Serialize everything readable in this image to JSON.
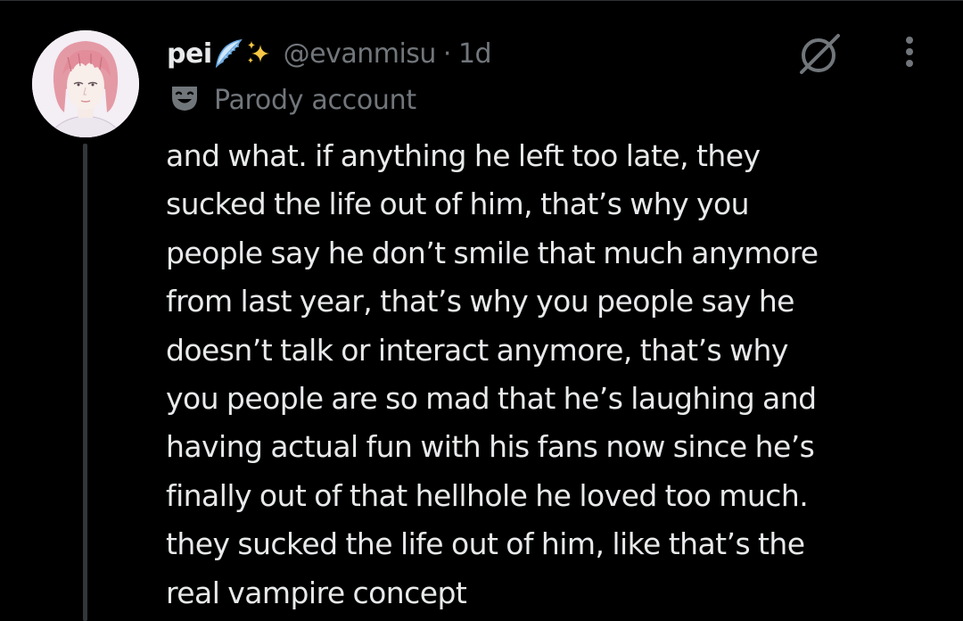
{
  "post": {
    "author": {
      "display_name": "pei",
      "display_name_emojis": [
        "wing-emoji",
        "sparkles-emoji"
      ],
      "handle": "@evanmisu",
      "separator": "·",
      "time_ago": "1d"
    },
    "label": {
      "icon": "theater-mask-icon",
      "text": "Parody account"
    },
    "body_lines": [
      "and what. if anything he left too late, they",
      "sucked the life out of him, that’s why you",
      "people say he don’t smile that much anymore",
      "from last year, that’s why you people say he",
      "doesn’t talk or interact anymore, that’s why",
      "you people are so mad that he’s laughing and",
      "having actual fun with his fans now since he’s",
      "finally out of that hellhole he loved too much.",
      "they sucked the life out of him, like that’s the",
      "real vampire concept"
    ]
  },
  "actions": {
    "grok_icon": "grok-icon",
    "more_icon": "more-dots-icon"
  },
  "colors": {
    "background": "#000000",
    "primary_text": "#e7e9ea",
    "secondary_text": "#71767b",
    "thread_line": "#333639",
    "divider": "#2f3336"
  }
}
